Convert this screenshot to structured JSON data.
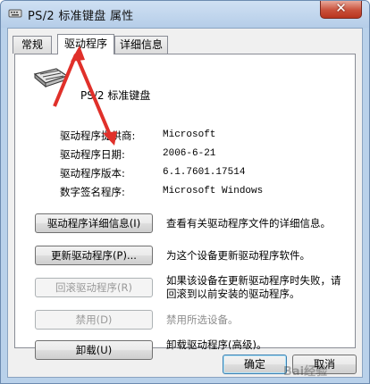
{
  "window": {
    "title": "PS/2 标准键盘 属性",
    "close_label": "✕"
  },
  "tabs": [
    {
      "label": "常规"
    },
    {
      "label": "驱动程序"
    },
    {
      "label": "详细信息"
    }
  ],
  "device": {
    "name": "PS/2 标准键盘"
  },
  "properties": [
    {
      "label": "驱动程序提供商:",
      "value": "Microsoft"
    },
    {
      "label": "驱动程序日期:",
      "value": "2006-6-21"
    },
    {
      "label": "驱动程序版本:",
      "value": "6.1.7601.17514"
    },
    {
      "label": "数字签名程序:",
      "value": "Microsoft Windows"
    }
  ],
  "actions": [
    {
      "button": "驱动程序详细信息(I)",
      "desc": "查看有关驱动程序文件的详细信息。",
      "enabled": true
    },
    {
      "button": "更新驱动程序(P)...",
      "desc": "为这个设备更新驱动程序软件。",
      "enabled": true
    },
    {
      "button": "回滚驱动程序(R)",
      "desc_line1": "如果该设备在更新驱动程序时失败，请",
      "desc_line2": "回滚到以前安装的驱动程序。",
      "enabled": false
    },
    {
      "button": "禁用(D)",
      "desc": "禁用所选设备。",
      "enabled": false
    },
    {
      "button": "卸载(U)",
      "desc": "卸载驱动程序(高级)。",
      "enabled": true
    }
  ],
  "footer": {
    "ok_label": "确定",
    "cancel_label": "取消"
  },
  "watermark": "Bai经验",
  "colors": {
    "annotation_arrow": "#e0302a"
  }
}
